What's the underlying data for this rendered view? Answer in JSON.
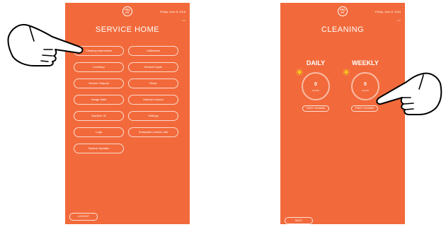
{
  "left_screen": {
    "logo_text": "PRO\nFIT",
    "date": "Friday, June 8, 2018",
    "version": "v1.0",
    "title": "SERVICE HOME",
    "buttons": [
      "Cleaning Instructions",
      "Calibration",
      "Inventory",
      "Service Inputs",
      "Service Outputs",
      "Rinse",
      "Usage Stats",
      "Manual Lockout",
      "Machine ID",
      "Settings",
      "Logs",
      "Subsystem version info",
      "System Updates"
    ],
    "logout_label": "LOGOUT"
  },
  "right_screen": {
    "logo_text": "PRO\nFIT",
    "date": "Friday, June 8, 2018",
    "version": "v1.0",
    "title": "CLEANING",
    "daily": {
      "label": "DAILY",
      "value": "0",
      "unit": "HOURS",
      "button": "START CLEANING"
    },
    "weekly": {
      "label": "WEEKLY",
      "value": "0",
      "unit": "HOURS",
      "button": "START CLEANING"
    },
    "back_label": "BACK"
  },
  "colors": {
    "screen_bg": "#f26a3b",
    "sun": "#f7d51b"
  },
  "icons": {
    "hand_pointer": "pointing-hand-icon",
    "sun": "sun-icon",
    "logo": "brand-logo-icon"
  }
}
